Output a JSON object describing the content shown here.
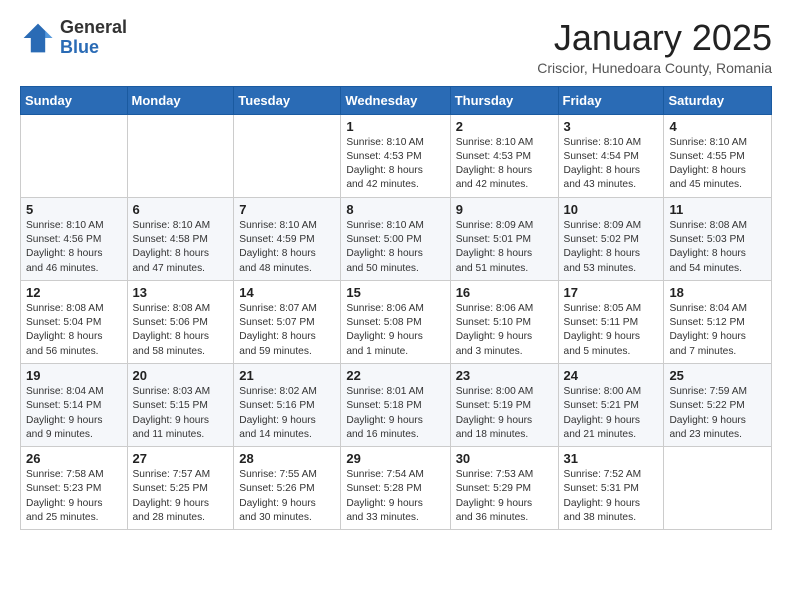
{
  "header": {
    "logo_general": "General",
    "logo_blue": "Blue",
    "month_title": "January 2025",
    "location": "Criscior, Hunedoara County, Romania"
  },
  "weekdays": [
    "Sunday",
    "Monday",
    "Tuesday",
    "Wednesday",
    "Thursday",
    "Friday",
    "Saturday"
  ],
  "weeks": [
    [
      {
        "day": "",
        "info": ""
      },
      {
        "day": "",
        "info": ""
      },
      {
        "day": "",
        "info": ""
      },
      {
        "day": "1",
        "info": "Sunrise: 8:10 AM\nSunset: 4:53 PM\nDaylight: 8 hours\nand 42 minutes."
      },
      {
        "day": "2",
        "info": "Sunrise: 8:10 AM\nSunset: 4:53 PM\nDaylight: 8 hours\nand 42 minutes."
      },
      {
        "day": "3",
        "info": "Sunrise: 8:10 AM\nSunset: 4:54 PM\nDaylight: 8 hours\nand 43 minutes."
      },
      {
        "day": "4",
        "info": "Sunrise: 8:10 AM\nSunset: 4:55 PM\nDaylight: 8 hours\nand 45 minutes."
      }
    ],
    [
      {
        "day": "5",
        "info": "Sunrise: 8:10 AM\nSunset: 4:56 PM\nDaylight: 8 hours\nand 46 minutes."
      },
      {
        "day": "6",
        "info": "Sunrise: 8:10 AM\nSunset: 4:58 PM\nDaylight: 8 hours\nand 47 minutes."
      },
      {
        "day": "7",
        "info": "Sunrise: 8:10 AM\nSunset: 4:59 PM\nDaylight: 8 hours\nand 48 minutes."
      },
      {
        "day": "8",
        "info": "Sunrise: 8:10 AM\nSunset: 5:00 PM\nDaylight: 8 hours\nand 50 minutes."
      },
      {
        "day": "9",
        "info": "Sunrise: 8:09 AM\nSunset: 5:01 PM\nDaylight: 8 hours\nand 51 minutes."
      },
      {
        "day": "10",
        "info": "Sunrise: 8:09 AM\nSunset: 5:02 PM\nDaylight: 8 hours\nand 53 minutes."
      },
      {
        "day": "11",
        "info": "Sunrise: 8:08 AM\nSunset: 5:03 PM\nDaylight: 8 hours\nand 54 minutes."
      }
    ],
    [
      {
        "day": "12",
        "info": "Sunrise: 8:08 AM\nSunset: 5:04 PM\nDaylight: 8 hours\nand 56 minutes."
      },
      {
        "day": "13",
        "info": "Sunrise: 8:08 AM\nSunset: 5:06 PM\nDaylight: 8 hours\nand 58 minutes."
      },
      {
        "day": "14",
        "info": "Sunrise: 8:07 AM\nSunset: 5:07 PM\nDaylight: 8 hours\nand 59 minutes."
      },
      {
        "day": "15",
        "info": "Sunrise: 8:06 AM\nSunset: 5:08 PM\nDaylight: 9 hours\nand 1 minute."
      },
      {
        "day": "16",
        "info": "Sunrise: 8:06 AM\nSunset: 5:10 PM\nDaylight: 9 hours\nand 3 minutes."
      },
      {
        "day": "17",
        "info": "Sunrise: 8:05 AM\nSunset: 5:11 PM\nDaylight: 9 hours\nand 5 minutes."
      },
      {
        "day": "18",
        "info": "Sunrise: 8:04 AM\nSunset: 5:12 PM\nDaylight: 9 hours\nand 7 minutes."
      }
    ],
    [
      {
        "day": "19",
        "info": "Sunrise: 8:04 AM\nSunset: 5:14 PM\nDaylight: 9 hours\nand 9 minutes."
      },
      {
        "day": "20",
        "info": "Sunrise: 8:03 AM\nSunset: 5:15 PM\nDaylight: 9 hours\nand 11 minutes."
      },
      {
        "day": "21",
        "info": "Sunrise: 8:02 AM\nSunset: 5:16 PM\nDaylight: 9 hours\nand 14 minutes."
      },
      {
        "day": "22",
        "info": "Sunrise: 8:01 AM\nSunset: 5:18 PM\nDaylight: 9 hours\nand 16 minutes."
      },
      {
        "day": "23",
        "info": "Sunrise: 8:00 AM\nSunset: 5:19 PM\nDaylight: 9 hours\nand 18 minutes."
      },
      {
        "day": "24",
        "info": "Sunrise: 8:00 AM\nSunset: 5:21 PM\nDaylight: 9 hours\nand 21 minutes."
      },
      {
        "day": "25",
        "info": "Sunrise: 7:59 AM\nSunset: 5:22 PM\nDaylight: 9 hours\nand 23 minutes."
      }
    ],
    [
      {
        "day": "26",
        "info": "Sunrise: 7:58 AM\nSunset: 5:23 PM\nDaylight: 9 hours\nand 25 minutes."
      },
      {
        "day": "27",
        "info": "Sunrise: 7:57 AM\nSunset: 5:25 PM\nDaylight: 9 hours\nand 28 minutes."
      },
      {
        "day": "28",
        "info": "Sunrise: 7:55 AM\nSunset: 5:26 PM\nDaylight: 9 hours\nand 30 minutes."
      },
      {
        "day": "29",
        "info": "Sunrise: 7:54 AM\nSunset: 5:28 PM\nDaylight: 9 hours\nand 33 minutes."
      },
      {
        "day": "30",
        "info": "Sunrise: 7:53 AM\nSunset: 5:29 PM\nDaylight: 9 hours\nand 36 minutes."
      },
      {
        "day": "31",
        "info": "Sunrise: 7:52 AM\nSunset: 5:31 PM\nDaylight: 9 hours\nand 38 minutes."
      },
      {
        "day": "",
        "info": ""
      }
    ]
  ]
}
